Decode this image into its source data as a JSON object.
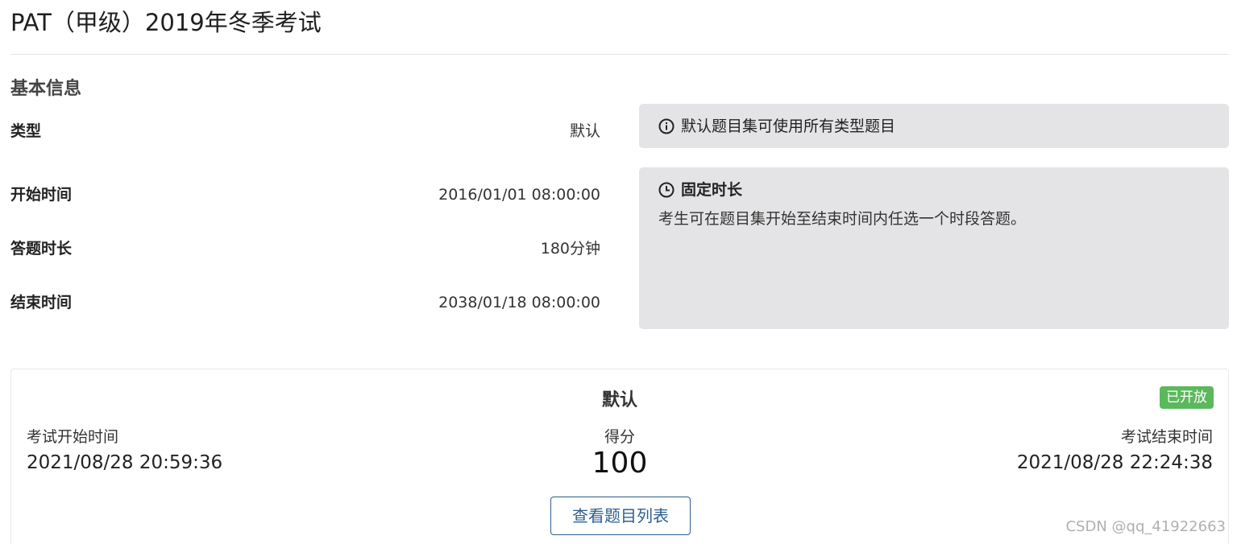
{
  "page": {
    "title": "PAT（甲级）2019年冬季考试"
  },
  "basic_info": {
    "heading": "基本信息",
    "rows": [
      {
        "label": "类型",
        "value": "默认"
      },
      {
        "label": "开始时间",
        "value": "2016/01/01 08:00:00"
      },
      {
        "label": "答题时长",
        "value": "180分钟"
      },
      {
        "label": "结束时间",
        "value": "2038/01/18 08:00:00"
      }
    ]
  },
  "notes": {
    "type_note": {
      "icon": "info-circle-icon",
      "text": "默认题目集可使用所有类型题目"
    },
    "duration_note": {
      "icon": "clock-icon",
      "title": "固定时长",
      "text": "考生可在题目集开始至结束时间内任选一个时段答题。"
    }
  },
  "exam_card": {
    "title": "默认",
    "status_badge": "已开放",
    "status_color": "#5cb85c",
    "start_label": "考试开始时间",
    "start_value": "2021/08/28 20:59:36",
    "score_label": "得分",
    "score_value": "100",
    "end_label": "考试结束时间",
    "end_value": "2021/08/28 22:24:38",
    "view_button_label": "查看题目列表"
  },
  "watermark": "CSDN @qq_41922663"
}
